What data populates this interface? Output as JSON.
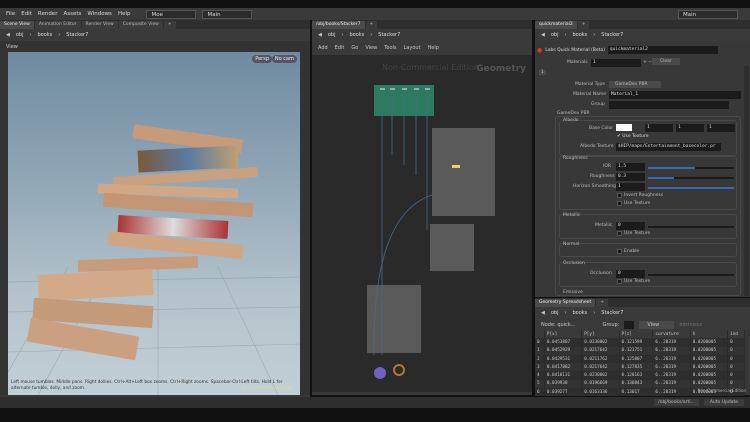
{
  "menu": [
    "File",
    "Edit",
    "Render",
    "Assets",
    "Windows",
    "Help"
  ],
  "desktop": "Moe",
  "desktop2": "Main",
  "main_right": "Main",
  "left_tabs": [
    "Scene View",
    "Animation Editor",
    "Render View",
    "Composite View"
  ],
  "center_tab": "/obj/books/Stacker7",
  "right_tab": "quickmaterial2",
  "spread_tab": "Geometry Spreadsheet",
  "path": [
    "obj",
    "books",
    "Stacker7"
  ],
  "viewport": {
    "title": "View",
    "persp": "Persp",
    "cam": "No cam",
    "hint": "Left mouse tumbles. Middle pans. Right dollies. Ctrl+Alt+Left box zooms. Ctrl+Right zooms. Spacebar-Ctrl-Left tilts. Hold L for alternate tumble, dolly, and zoom.",
    "watermark": "Non-Commercial Edition"
  },
  "network": {
    "menu": [
      "Add",
      "Edit",
      "Go",
      "View",
      "Tools",
      "Layout",
      "Help"
    ],
    "watermark": "Non-Commercial Edition",
    "context": "Geometry"
  },
  "params": {
    "node_type": "Labs Quick Material (Beta)",
    "node_name": "quickmaterial2",
    "materials_label": "Materials",
    "materials_value": "1",
    "clear": "Clear",
    "tab": "1",
    "material_type_label": "Material Type",
    "material_type": "GameDev PBR",
    "material_name_label": "Material Name",
    "material_name": "Material_1",
    "group_label": "Group",
    "section": "GameDev PBR",
    "albedo": "Albedo",
    "base_color_label": "Base Color",
    "base_color": [
      "1",
      "1",
      "1"
    ],
    "use_texture": "Use Texture",
    "albedo_texture_label": "Albedo Texture",
    "albedo_texture": "$HIP/maps/Entertainment_basecolor.pr",
    "roughness": "Roughness",
    "ior_label": "IOR",
    "ior": "1.5",
    "ior_frac": 0.55,
    "roughness_label": "Roughness",
    "roughness_value": "0.3",
    "roughness_frac": 0.3,
    "horizon_label": "Horizon Smoothing",
    "horizon": "1",
    "horizon_frac": 1.0,
    "invert_roughness": "Invert Roughness",
    "metallic": "Metallic",
    "metallic_label": "Metallic",
    "metallic_value": "0",
    "normal": "Normal",
    "enable": "Enable",
    "occlusion": "Occlusion",
    "occlusion_label": "Occlusion",
    "occlusion_value": "0",
    "emissive": "Emissive"
  },
  "spreadsheet": {
    "node": "Node: quick...",
    "group": "Group:",
    "view": "View",
    "intrinsics": "Intrinsics",
    "columns": [
      "",
      "P[x]",
      "P[y]",
      "P[z]",
      "curvature",
      "h",
      "ind"
    ],
    "rows": [
      [
        "0",
        "0.0453807",
        "0.0230002",
        "0.121599",
        "6..28319",
        "0.0200005",
        "0"
      ],
      [
        "1",
        "0.0452929",
        "0.0217642",
        "0.121751",
        "6..28319",
        "0.0200005",
        "0"
      ],
      [
        "2",
        "0.0429531",
        "0.0211762",
        "0.125807",
        "6..28319",
        "0.0200005",
        "0"
      ],
      [
        "3",
        "0.0417882",
        "0.0217642",
        "0.127835",
        "6..28319",
        "0.0200005",
        "0"
      ],
      [
        "4",
        "0.0410131",
        "0.0230002",
        "0.128163",
        "6..28319",
        "0.0200005",
        "0"
      ],
      [
        "5",
        "0.039938",
        "0.0196669",
        "0.130843",
        "6..28319",
        "0.0200005",
        "0"
      ],
      [
        "6",
        "0.039277",
        "0.0163336",
        "0.13017",
        "6..28319",
        "0.0200005",
        "0"
      ]
    ],
    "watermark": "Non-Commercial Edition"
  },
  "status": {
    "path": "/obj/books/arti...",
    "auto_update": "Auto Update"
  }
}
